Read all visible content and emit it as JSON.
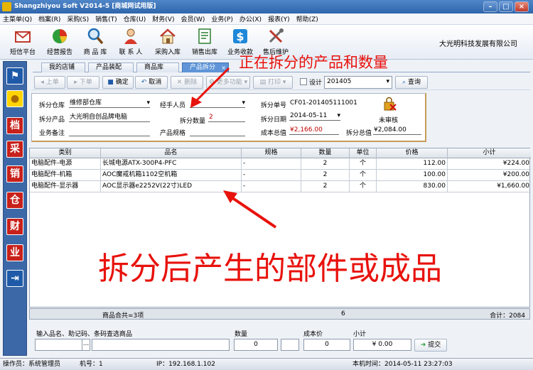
{
  "window": {
    "title": "Shangzhiyou Soft V2014-5 [商城网试用版]"
  },
  "menu": [
    "主菜单(Q)",
    "档案(R)",
    "采购(S)",
    "销售(T)",
    "仓库(U)",
    "财务(V)",
    "会员(W)",
    "业务(P)",
    "办公(X)",
    "报表(Y)",
    "帮助(Z)"
  ],
  "toolbar": {
    "items": [
      "短信平台",
      "经营报告",
      "商 品 库",
      "联 系 人",
      "采购入库",
      "销售出库",
      "业务收款",
      "售后维护"
    ],
    "company": "大光明科技发展有限公司"
  },
  "tabs": [
    "我的店铺",
    "产品装配",
    "商品库",
    "产品拆分"
  ],
  "actions": {
    "prev": "上单",
    "next": "下单",
    "confirm": "确定",
    "cancel": "取消",
    "delete": "删除",
    "more": "更多功能",
    "print": "打印",
    "design": "设计",
    "period": "201405",
    "query": "查询"
  },
  "form": {
    "warehouse_label": "拆分仓库",
    "warehouse_value": "维修部仓库",
    "handler_label": "经手人员",
    "doc_no_label": "拆分单号",
    "doc_no_value": "CF01-201405111001",
    "product_label": "拆分产品",
    "product_value": "大光明自创品牌电脑",
    "qty_label": "拆分数量",
    "qty_value": "2",
    "date_label": "拆分日期",
    "date_value": "2014-05-11",
    "remark_label": "业务备注",
    "spec_label": "产品规格",
    "cost_label": "成本总值",
    "cost_value": "¥2,166.00",
    "split_total_label": "拆分总值",
    "split_total_value": "¥2,084.00",
    "audit_status": "未审核"
  },
  "grid": {
    "columns": [
      "类别",
      "品名",
      "规格",
      "数量",
      "单位",
      "价格",
      "小计"
    ],
    "rows": [
      [
        "电脑配件-电源",
        "长城电源ATX-300P4-PFC",
        "-",
        "2",
        "个",
        "112.00",
        "¥224.00"
      ],
      [
        "电脑配件-机箱",
        "AOC魔戒机箱1102空机箱",
        "-",
        "2",
        "个",
        "100.00",
        "¥200.00"
      ],
      [
        "电脑配件-显示器",
        "AOC显示器e2252V(22寸)LED",
        "-",
        "2",
        "个",
        "830.00",
        "¥1,660.00"
      ]
    ],
    "footer_count": "商品合共=3项",
    "footer_qty": "6",
    "footer_total": "合计：2084"
  },
  "entry": {
    "name_label": "输入品名、助记码、条码查选商品",
    "qty_label": "数量",
    "qty_value": "0",
    "cost_label": "成本价",
    "cost_value": "0",
    "subtotal_label": "小计",
    "subtotal_value": "¥ 0.00",
    "browse": "...",
    "submit": "提交"
  },
  "status": {
    "operator": "操作员：系统管理员",
    "machine": "机号：1",
    "ip": "IP：192.168.1.102",
    "time": "本机时间：2014-05-11 23:27:03"
  },
  "annotations": {
    "top": "正在拆分的产品和数量",
    "bottom": "拆分后产生的部件或成品"
  },
  "colors": {
    "annotation": "#e8120c",
    "sidebar": "#3c68a8",
    "active_tab": "#5f95d8"
  }
}
